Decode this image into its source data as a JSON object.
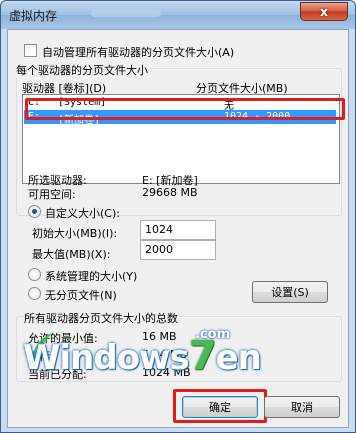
{
  "window": {
    "title": "虚拟内存",
    "close_glyph": "x"
  },
  "auto_manage": {
    "label": "自动管理所有驱动器的分页文件大小(A)",
    "checked": false
  },
  "per_drive": {
    "group_title": "每个驱动器的分页文件大小",
    "col_drive": "驱动器 [卷标](D)",
    "col_size": "分页文件大小(MB)",
    "rows": [
      {
        "drive": "C:",
        "label": "[System]",
        "size": "无",
        "selected": false
      },
      {
        "drive": "E:",
        "label": "[新加卷]",
        "size": "1024 - 2000",
        "selected": true
      }
    ]
  },
  "selected_drive": {
    "label": "所选驱动器:",
    "value": "E:  [新加卷]"
  },
  "free_space": {
    "label": "可用空间:",
    "value": "29668 MB"
  },
  "custom_size": {
    "label": "自定义大小(C):",
    "selected": true
  },
  "initial_size": {
    "label": "初始大小(MB)(I):",
    "value": "1024"
  },
  "max_size": {
    "label": "最大值(MB)(X):",
    "value": "2000"
  },
  "system_managed": {
    "label": "系统管理的大小(Y)",
    "selected": false
  },
  "no_paging": {
    "label": "无分页文件(N)",
    "selected": false
  },
  "set_button": "设置(S)",
  "totals": {
    "group_title": "所有驱动器分页文件大小的总数",
    "allowed_min_label": "允许的最小值:",
    "allowed_min_value": "16 MB",
    "recommended_label": "推荐:",
    "recommended_value": "5...4 MB",
    "current_label": "当前已分配:",
    "current_value": "1024 MB"
  },
  "ok_button": "确定",
  "cancel_button": "取消",
  "watermark": {
    "text": "Windows",
    "seven": "7",
    "en": "en",
    "com": ".com"
  },
  "colors": {
    "highlight": "#e21d1d",
    "selection": "#3399ff",
    "close": "#c13a1f"
  }
}
